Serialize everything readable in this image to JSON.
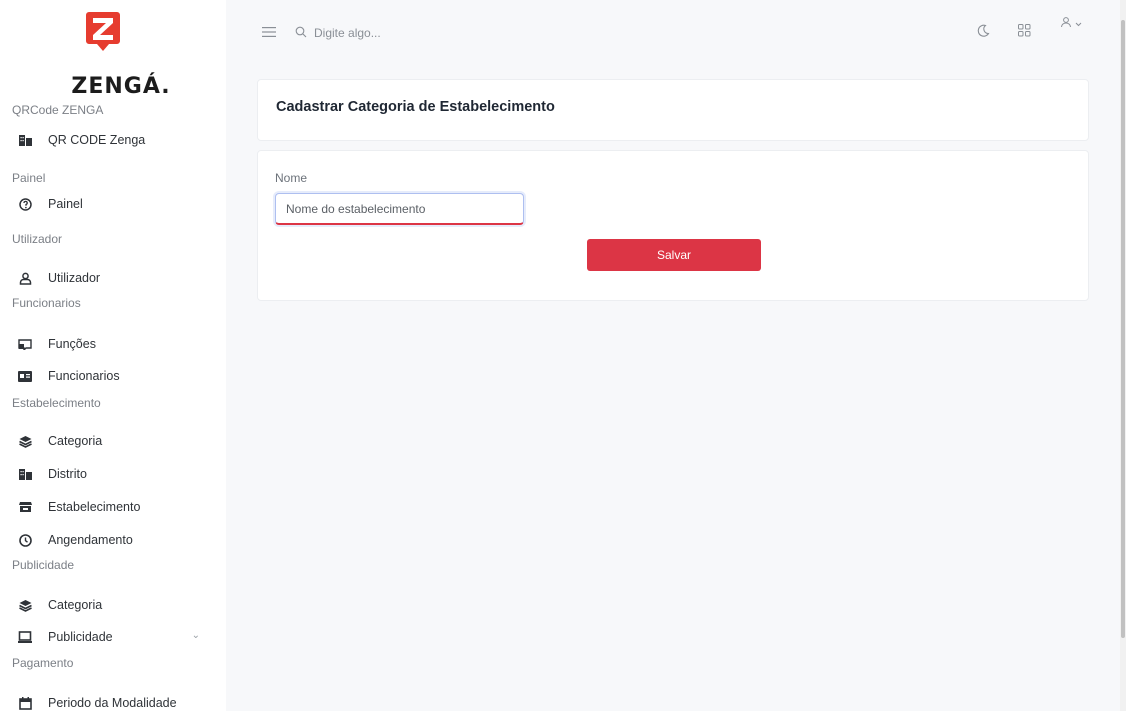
{
  "brand": {
    "name": "ZENGÁ.",
    "logo_icon": "zenga-logo-icon",
    "accent_color": "#e63c2f"
  },
  "sidebar": {
    "sections": [
      {
        "label": "QRCode ZENGA",
        "items": [
          {
            "label": "QR CODE Zenga",
            "icon": "buildings-icon"
          }
        ]
      },
      {
        "label": "Painel",
        "items": [
          {
            "label": "Painel",
            "icon": "dashboard-icon"
          }
        ]
      },
      {
        "label": "Utilizador",
        "items": [
          {
            "label": "Utilizador",
            "icon": "user-icon"
          }
        ]
      },
      {
        "label": "Funcionarios",
        "items": [
          {
            "label": "Funções",
            "icon": "briefcase-icon"
          },
          {
            "label": "Funcionarios",
            "icon": "id-card-icon"
          }
        ]
      },
      {
        "label": "Estabelecimento",
        "items": [
          {
            "label": "Categoria",
            "icon": "layers-icon"
          },
          {
            "label": "Distrito",
            "icon": "buildings-icon"
          },
          {
            "label": "Estabelecimento",
            "icon": "store-icon"
          },
          {
            "label": "Angendamento",
            "icon": "clock-icon"
          }
        ]
      },
      {
        "label": "Publicidade",
        "items": [
          {
            "label": "Categoria",
            "icon": "layers-icon"
          },
          {
            "label": "Publicidade",
            "icon": "laptop-icon",
            "has_submenu": true
          }
        ]
      },
      {
        "label": "Pagamento",
        "items": [
          {
            "label": "Periodo da Modalidade",
            "icon": "calendar-icon"
          }
        ]
      }
    ]
  },
  "topbar": {
    "search_placeholder": "Digite algo..."
  },
  "page": {
    "title": "Cadastrar Categoria de Estabelecimento",
    "form": {
      "name_label": "Nome",
      "name_placeholder": "Nome do estabelecimento",
      "name_value": "",
      "save_label": "Salvar"
    }
  },
  "colors": {
    "primary_button": "#dc3545",
    "background": "#f7f8fa"
  }
}
